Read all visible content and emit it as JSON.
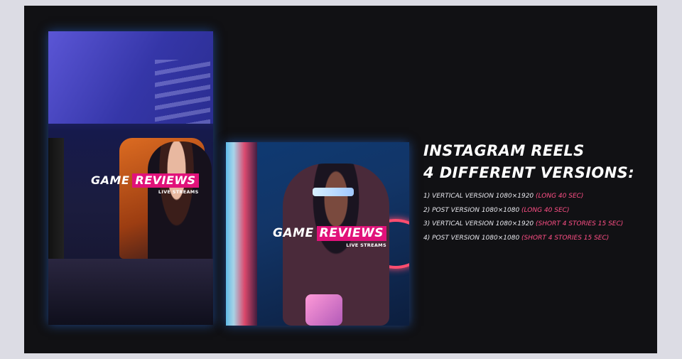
{
  "cards": {
    "vertical": {
      "title_white": "GAME",
      "title_pink": "REVIEWS",
      "subtitle": "LIVE STREAMS"
    },
    "square": {
      "title_white": "GAME",
      "title_pink": "REVIEWS",
      "subtitle": "LIVE STREAMS"
    }
  },
  "heading": {
    "line1": "INSTAGRAM REELS",
    "line2": "4 DIFFERENT VERSIONS:"
  },
  "versions": [
    {
      "text": "1) VERTICAL VERSION 1080×1920 ",
      "note": "(LONG 40 SEC)"
    },
    {
      "text": "2) POST VERSION 1080×1080 ",
      "note": "(LONG 40 SEC)"
    },
    {
      "text": "3) VERTICAL VERSION 1080×1920 ",
      "note": "(SHORT 4 STORIES 15 SEC)"
    },
    {
      "text": "4) POST VERSION 1080×1080 ",
      "note": "(SHORT 4 STORIES 15 SEC)"
    }
  ],
  "colors": {
    "accent_pink": "#e1127a",
    "note_pink": "#ff4f86",
    "background": "#111114",
    "glow_blue": "#286edc"
  }
}
